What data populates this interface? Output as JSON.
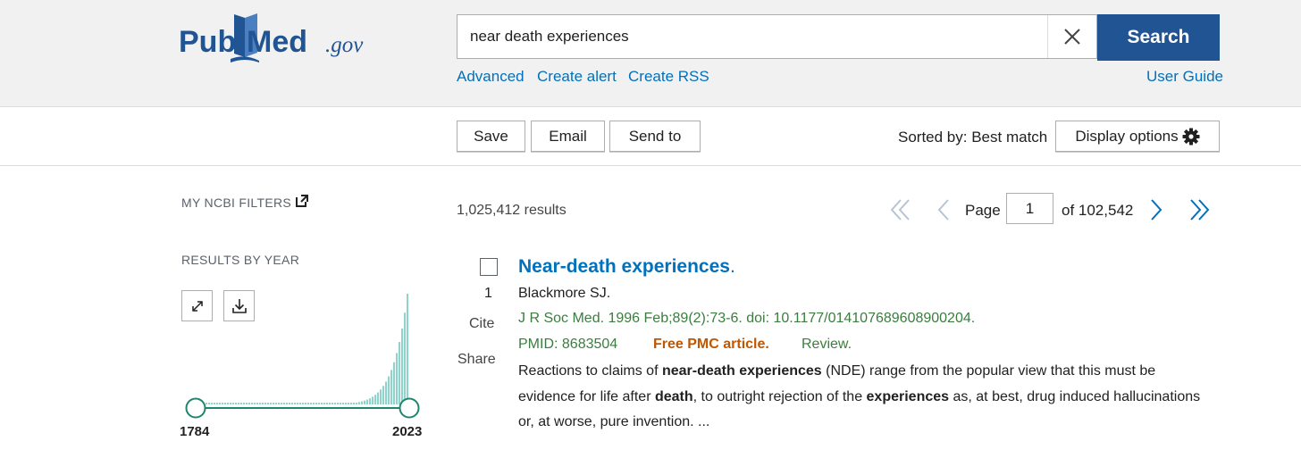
{
  "header": {
    "logo_main": "PubMed",
    "logo_suffix": ".gov",
    "search": {
      "value": "near death experiences",
      "button": "Search"
    },
    "links": {
      "advanced": "Advanced",
      "create_alert": "Create alert",
      "create_rss": "Create RSS",
      "user_guide": "User Guide"
    },
    "colors": {
      "brand": "#205493",
      "link": "#0071bc"
    }
  },
  "toolbar": {
    "save": "Save",
    "email": "Email",
    "send_to": "Send to",
    "sorted_by": "Sorted by: Best match",
    "display_options": "Display options",
    "display_icon": "gear-icon"
  },
  "sidebar": {
    "filters_heading": "MY NCBI FILTERS",
    "filters_icon": "external-link-icon",
    "year_heading": "RESULTS BY YEAR",
    "expand_icon": "expand-icon",
    "download_icon": "download-icon",
    "year_start": "1784",
    "year_end": "2023",
    "histogram_color": "#8fd3cb",
    "slider_color": "#20856f"
  },
  "results": {
    "count": "1,025,412 results",
    "page_label": "Page",
    "page_value": "1",
    "page_total": "of 102,542"
  },
  "article": {
    "number": "1",
    "cite": "Cite",
    "share": "Share",
    "title": "Near-death experiences",
    "title_suffix": ".",
    "authors": "Blackmore SJ.",
    "citation": "J R Soc Med. 1996 Feb;89(2):73-6. doi: 10.1177/014107689608900204.",
    "pmid": "PMID: 8683504",
    "free_pmc": "Free PMC article.",
    "review": "Review.",
    "snippet": {
      "s1": "Reactions to claims of ",
      "b1": "near-death experiences",
      "s2": " (NDE) range from the popular view that this must be evidence for life after ",
      "b2": "death",
      "s3": ", to outright rejection of the ",
      "b3": "experiences",
      "s4": " as, at best, drug induced hallucinations or, at worse, pure invention. ..."
    }
  }
}
